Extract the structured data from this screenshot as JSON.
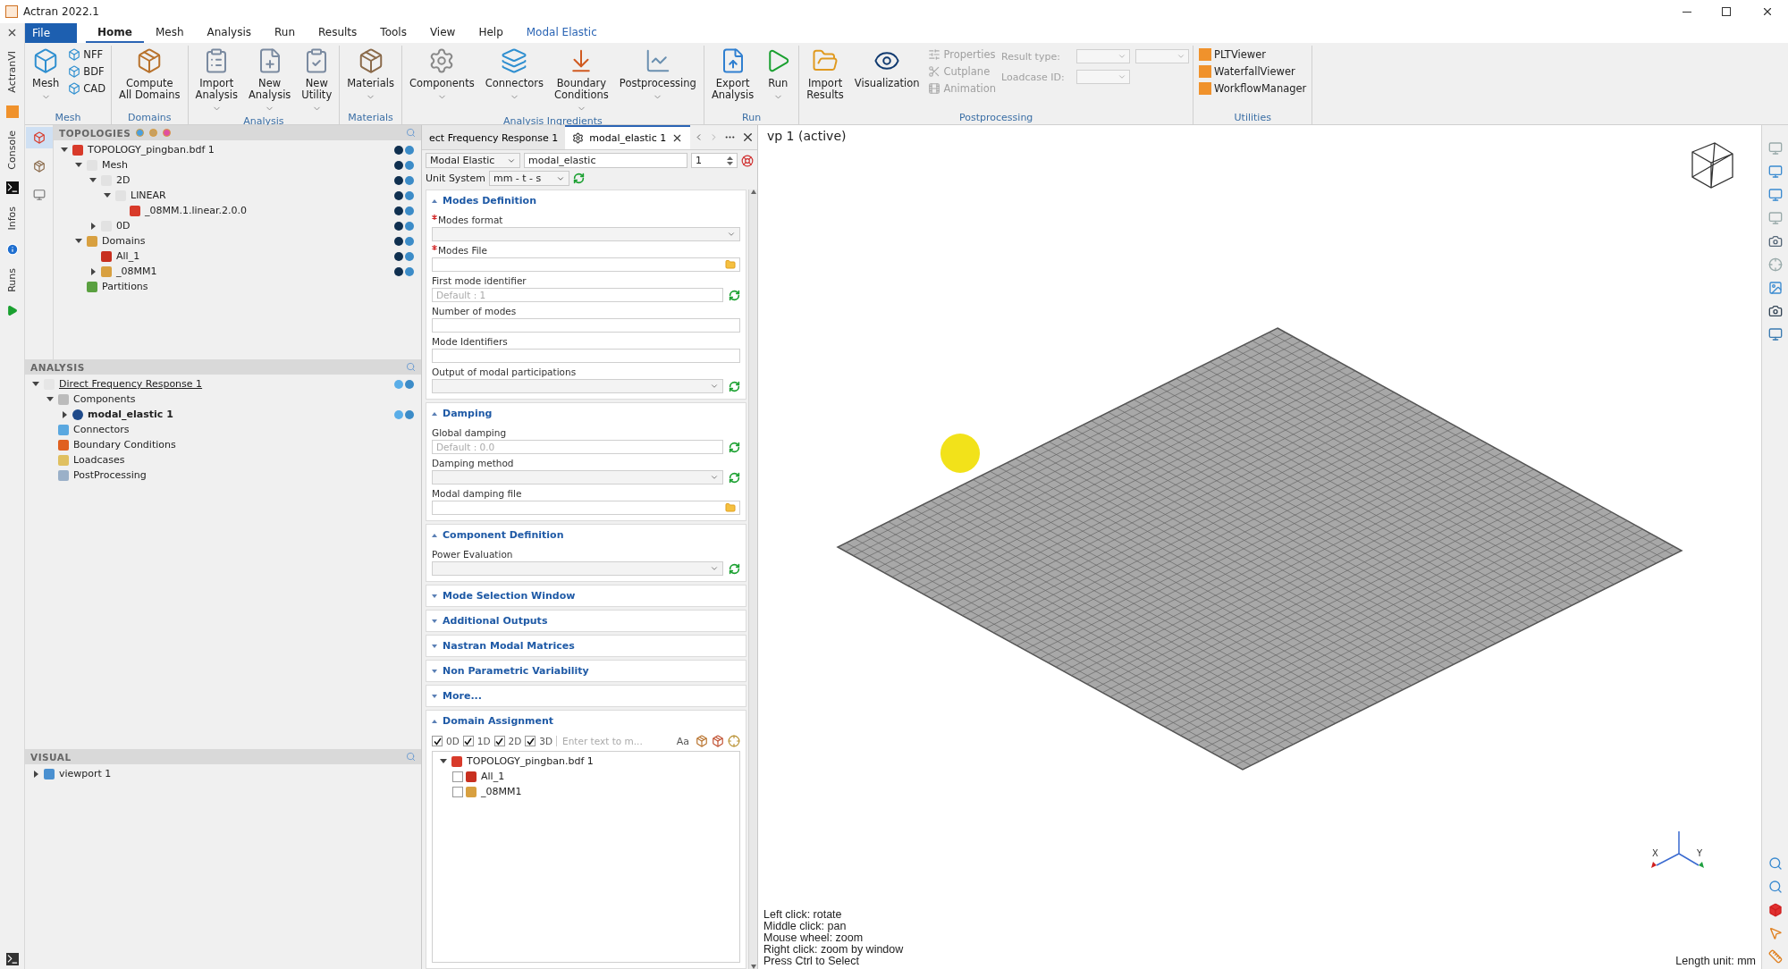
{
  "window": {
    "title": "Actran 2022.1"
  },
  "side_tabs": [
    {
      "label": "ActranVI"
    },
    {
      "label": "Console"
    },
    {
      "label": "Infos"
    },
    {
      "label": "Runs"
    }
  ],
  "ribbon": {
    "file_button": "File",
    "tabs": [
      {
        "label": "Home",
        "selected": true,
        "kind": "main"
      },
      {
        "label": "Mesh",
        "selected": false,
        "kind": "main"
      },
      {
        "label": "Analysis",
        "selected": false,
        "kind": "main"
      },
      {
        "label": "Run",
        "selected": false,
        "kind": "main"
      },
      {
        "label": "Results",
        "selected": false,
        "kind": "main"
      },
      {
        "label": "Tools",
        "selected": false,
        "kind": "main"
      },
      {
        "label": "View",
        "selected": false,
        "kind": "main"
      },
      {
        "label": "Help",
        "selected": false,
        "kind": "main"
      },
      {
        "label": "Modal Elastic",
        "selected": false,
        "kind": "context"
      }
    ],
    "groups": [
      {
        "label": "Mesh",
        "items": [
          {
            "kind": "large",
            "label": "Mesh",
            "dropdown": true
          },
          {
            "kind": "small_stack",
            "items": [
              {
                "label": "NFF",
                "disabled": false
              },
              {
                "label": "BDF",
                "disabled": false
              },
              {
                "label": "CAD",
                "disabled": false
              }
            ]
          }
        ]
      },
      {
        "label": "Domains",
        "items": [
          {
            "kind": "large",
            "label": "Compute\nAll Domains",
            "dropdown": false
          }
        ]
      },
      {
        "label": "Analysis",
        "items": [
          {
            "kind": "large",
            "label": "Import\nAnalysis",
            "dropdown": true
          },
          {
            "kind": "large",
            "label": "New\nAnalysis",
            "dropdown": true
          },
          {
            "kind": "large",
            "label": "New\nUtility",
            "dropdown": true
          }
        ]
      },
      {
        "label": "Materials",
        "items": [
          {
            "kind": "large",
            "label": "Materials",
            "dropdown": true
          }
        ]
      },
      {
        "label": "Analysis Ingredients",
        "items": [
          {
            "kind": "large",
            "label": "Components",
            "dropdown": true
          },
          {
            "kind": "large",
            "label": "Connectors",
            "dropdown": true
          },
          {
            "kind": "large",
            "label": "Boundary\nConditions",
            "dropdown": true
          },
          {
            "kind": "large",
            "label": "Postprocessing",
            "dropdown": true
          }
        ]
      },
      {
        "label": "Run",
        "items": [
          {
            "kind": "large",
            "label": "Export\nAnalysis",
            "dropdown": false
          },
          {
            "kind": "large",
            "label": "Run",
            "dropdown": true
          }
        ]
      },
      {
        "label": "Postprocessing",
        "items": [
          {
            "kind": "large",
            "label": "Import\nResults",
            "dropdown": false
          },
          {
            "kind": "large",
            "label": "Visualization",
            "dropdown": false
          },
          {
            "kind": "small_stack",
            "items": [
              {
                "label": "Properties",
                "disabled": true
              },
              {
                "label": "Cutplane",
                "disabled": true
              },
              {
                "label": "Animation",
                "disabled": true
              }
            ]
          },
          {
            "kind": "combo_block",
            "rows": [
              {
                "label": "Result type:",
                "extra_combo": true,
                "disabled": true
              },
              {
                "label": "Loadcase ID:",
                "extra_combo": false,
                "disabled": true
              }
            ]
          }
        ]
      },
      {
        "label": "Utilities",
        "items": [
          {
            "kind": "app_stack",
            "items": [
              {
                "label": "PLTViewer"
              },
              {
                "label": "WaterfallViewer"
              },
              {
                "label": "WorkflowManager"
              }
            ]
          }
        ]
      }
    ]
  },
  "topologies": {
    "title": "TOPOLOGIES",
    "tree": [
      {
        "label": "TOPOLOGY_pingban.bdf 1",
        "kind": "topology",
        "expanded": true,
        "visibility": true,
        "children": [
          {
            "label": "Mesh",
            "kind": "group",
            "expanded": true,
            "visibility": true,
            "children": [
              {
                "label": "2D",
                "kind": "group",
                "expanded": true,
                "visibility": true,
                "children": [
                  {
                    "label": "LINEAR",
                    "kind": "group",
                    "expanded": true,
                    "visibility": true,
                    "children": [
                      {
                        "label": "_08MM.1.linear.2.0.0",
                        "kind": "part",
                        "visibility": true
                      }
                    ]
                  }
                ]
              },
              {
                "label": "0D",
                "kind": "group",
                "expanded": false,
                "visibility": true
              }
            ]
          },
          {
            "label": "Domains",
            "kind": "domains",
            "expanded": true,
            "visibility": true,
            "children": [
              {
                "label": "All_1",
                "kind": "domain",
                "visibility": true
              },
              {
                "label": "_08MM1",
                "kind": "domains",
                "expanded": false,
                "visibility": true
              }
            ]
          },
          {
            "label": "Partitions",
            "kind": "partitions",
            "visibility": false
          }
        ]
      }
    ]
  },
  "analysis": {
    "title": "ANALYSIS",
    "tree": [
      {
        "label": "Direct Frequency Response 1",
        "kind": "analysis",
        "expanded": true,
        "selected": false,
        "visibility": true,
        "children": [
          {
            "label": "Components",
            "kind": "components",
            "expanded": true,
            "selected": false,
            "visibility": false,
            "children": [
              {
                "label": "modal_elastic 1",
                "kind": "component",
                "expanded": false,
                "selected": true,
                "visibility": true
              }
            ]
          },
          {
            "label": "Connectors",
            "kind": "connectors",
            "selected": false,
            "visibility": false
          },
          {
            "label": "Boundary Conditions",
            "kind": "conditions",
            "selected": false,
            "visibility": false
          },
          {
            "label": "Loadcases",
            "kind": "loadcases",
            "selected": false,
            "visibility": false
          },
          {
            "label": "PostProcessing",
            "kind": "postprocessing",
            "selected": false,
            "visibility": false
          }
        ]
      }
    ]
  },
  "visual": {
    "title": "VISUAL",
    "tree": [
      {
        "label": "viewport 1",
        "kind": "viewport",
        "expanded": false,
        "visibility": false
      }
    ]
  },
  "editor": {
    "tabs": [
      {
        "label": "ect Frequency Response 1",
        "selected": false
      },
      {
        "label": "modal_elastic 1",
        "selected": true
      }
    ],
    "type": "Modal Elastic",
    "name": "modal_elastic",
    "index": "1",
    "unit_label": "Unit System",
    "unit": "mm - t - s",
    "sections": [
      {
        "title": "Modes Definition",
        "kind": "fields",
        "expanded": true,
        "fields": [
          {
            "label": "Modes format",
            "kind": "combo",
            "required": true,
            "reset": false
          },
          {
            "label": "Modes File",
            "kind": "file",
            "required": true,
            "reset": false
          },
          {
            "label": "First mode identifier",
            "kind": "text",
            "placeholder": "Default : 1",
            "required": false,
            "reset": true
          },
          {
            "label": "Number of modes",
            "kind": "text",
            "required": false,
            "reset": false
          },
          {
            "label": "Mode Identifiers",
            "kind": "text",
            "required": false,
            "reset": false
          },
          {
            "label": "Output of modal participations",
            "kind": "combo",
            "required": false,
            "reset": true
          }
        ]
      },
      {
        "title": "Damping",
        "kind": "fields",
        "expanded": true,
        "fields": [
          {
            "label": "Global damping",
            "kind": "text",
            "placeholder": "Default : 0.0",
            "required": false,
            "reset": true
          },
          {
            "label": "Damping method",
            "kind": "combo",
            "required": false,
            "reset": true
          },
          {
            "label": "Modal damping file",
            "kind": "file",
            "required": false,
            "reset": false
          }
        ]
      },
      {
        "title": "Component Definition",
        "kind": "fields",
        "expanded": true,
        "fields": [
          {
            "label": "Power Evaluation",
            "kind": "combo",
            "required": false,
            "reset": true
          }
        ]
      },
      {
        "title": "Mode Selection Window",
        "kind": "fields",
        "expanded": false
      },
      {
        "title": "Additional Outputs",
        "kind": "fields",
        "expanded": false
      },
      {
        "title": "Nastran Modal Matrices",
        "kind": "fields",
        "expanded": false
      },
      {
        "title": "Non Parametric Variability",
        "kind": "fields",
        "expanded": false
      },
      {
        "title": "More...",
        "kind": "fields",
        "expanded": false
      },
      {
        "title": "Domain Assignment",
        "kind": "domains",
        "expanded": true,
        "filters": [
          {
            "label": "0D",
            "checked": true
          },
          {
            "label": "1D",
            "checked": true
          },
          {
            "label": "2D",
            "checked": true
          },
          {
            "label": "3D",
            "checked": true
          }
        ],
        "search_placeholder": "Enter text to m...",
        "case_button": "Aa",
        "tree": {
          "label": "TOPOLOGY_pingban.bdf 1",
          "expanded": true,
          "items": [
            {
              "label": "All_1",
              "kind": "domain",
              "checked": false
            },
            {
              "label": "_08MM1",
              "kind": "domains",
              "checked": false
            }
          ]
        }
      }
    ]
  },
  "viewport": {
    "title": "vp 1 (active)",
    "axis_labels": [
      "X",
      "Y"
    ],
    "hints": [
      "Left click: rotate",
      "Middle click: pan",
      "Mouse wheel: zoom",
      "Right click: zoom by window",
      "Press Ctrl to Select"
    ],
    "length_unit": "Length unit: mm"
  }
}
